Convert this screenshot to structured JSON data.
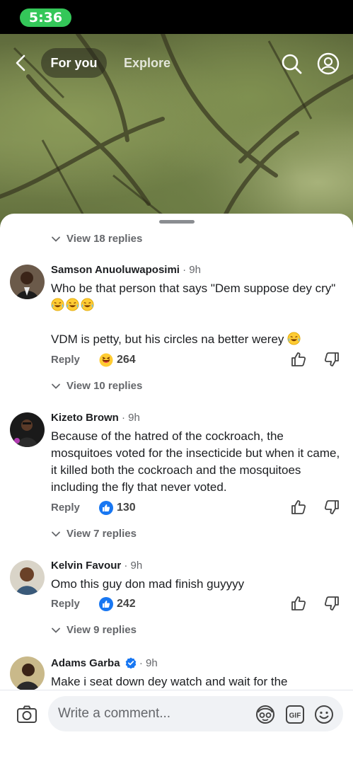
{
  "status_bar": {
    "time": "5:36"
  },
  "video_nav": {
    "for_you": "For you",
    "explore": "Explore"
  },
  "comments_sheet": {
    "view_replies_top": "View 18 replies",
    "comments": [
      {
        "author": "Samson Anuoluwaposimi",
        "time": " · 9h",
        "text_line1": "Who be that person that says \"Dem suppose dey cry\"",
        "text_line2": "VDM is petty, but his circles na better werey",
        "reply": "Reply",
        "reaction_icon": "haha-emoji",
        "reaction_count": "264",
        "view_replies": "View 10 replies"
      },
      {
        "author": "Kizeto Brown",
        "time": " · 9h",
        "text": "Because of the hatred of the cockroach, the mosquitoes voted for the insecticide but when it came, it killed both the cockroach and the mosquitoes including the fly that never voted.",
        "reply": "Reply",
        "reaction_icon": "like-icon",
        "reaction_count": "130",
        "view_replies": "View 7 replies"
      },
      {
        "author": "Kelvin Favour",
        "time": " · 9h",
        "text": "Omo this guy don mad finish guyyyy",
        "reply": "Reply",
        "reaction_icon": "like-icon",
        "reaction_count": "242",
        "view_replies": "View 9 replies"
      },
      {
        "author": "Adams Garba",
        "time": " · 9h",
        "verified": true,
        "text": "Make i seat down dey watch and wait for the"
      }
    ]
  },
  "composer": {
    "placeholder": "Write a comment..."
  },
  "colors": {
    "accent_blue": "#1877f2",
    "status_green": "#34c759",
    "secondary_text": "#65676b"
  }
}
